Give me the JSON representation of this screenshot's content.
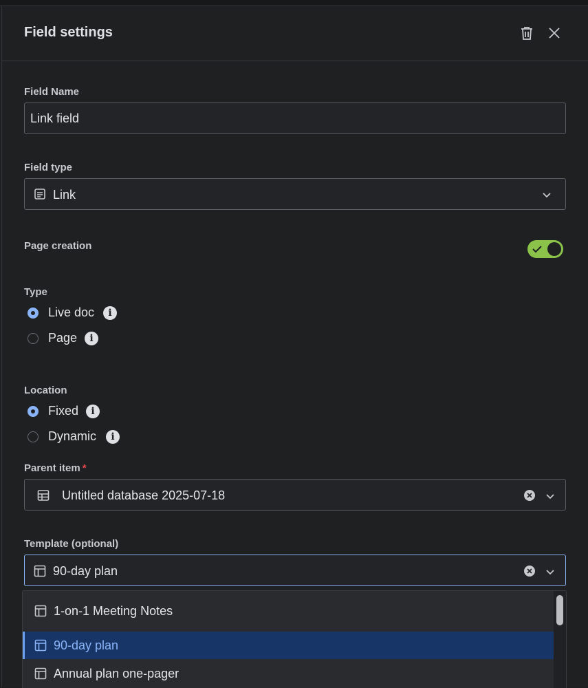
{
  "header": {
    "title": "Field settings"
  },
  "field_name": {
    "label": "Field Name",
    "value": "Link field"
  },
  "field_type": {
    "label": "Field type",
    "value": "Link"
  },
  "page_creation": {
    "label": "Page creation",
    "enabled": true
  },
  "type": {
    "label": "Type",
    "options": [
      {
        "label": "Live doc",
        "checked": true
      },
      {
        "label": "Page",
        "checked": false
      }
    ]
  },
  "location": {
    "label": "Location",
    "options": [
      {
        "label": "Fixed",
        "checked": true
      },
      {
        "label": "Dynamic",
        "checked": false
      }
    ]
  },
  "parent_item": {
    "label": "Parent item",
    "required_mark": "*",
    "value": "Untitled database 2025-07-18"
  },
  "template": {
    "label": "Template (optional)",
    "value": "90-day plan"
  },
  "template_options": [
    {
      "label": "1-on-1 Meeting Notes",
      "selected": false
    },
    {
      "label": "90-day plan",
      "selected": true
    },
    {
      "label": "Annual plan one-pager",
      "selected": false
    }
  ],
  "colors": {
    "accent": "#8ab4f8",
    "toggle_on": "#8bc34a",
    "selected_bg": "#173566"
  }
}
